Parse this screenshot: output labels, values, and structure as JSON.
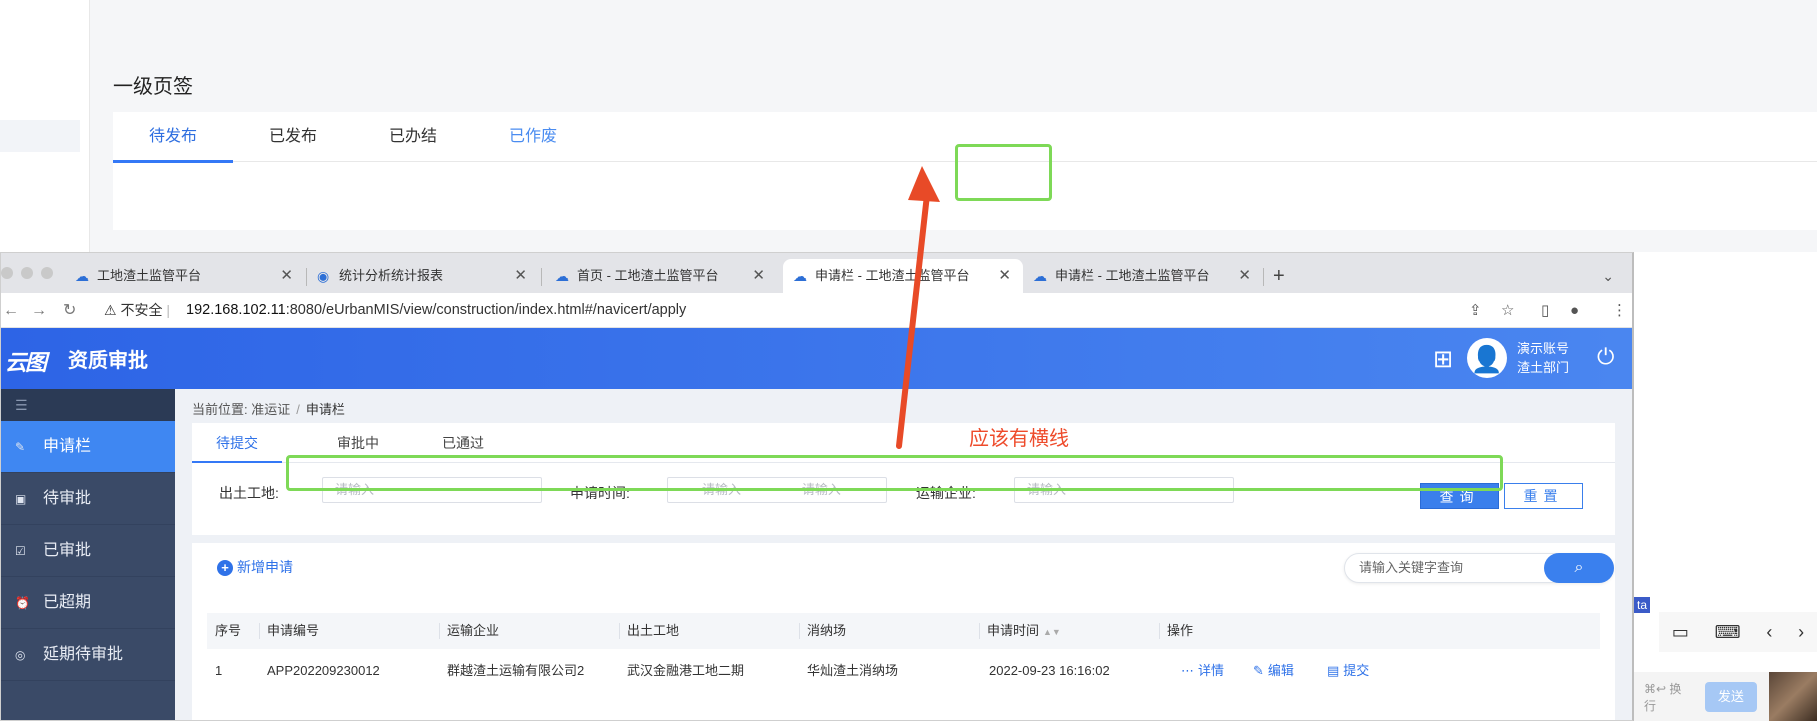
{
  "background_page": {
    "title": "一级页签",
    "tabs": [
      {
        "label": "待发布",
        "state": "active"
      },
      {
        "label": "已发布",
        "state": "normal"
      },
      {
        "label": "已办结",
        "state": "normal"
      },
      {
        "label": "已作废",
        "state": "highlight"
      }
    ],
    "side_tag": "ta",
    "chat_hint": "⌘↩ 换行",
    "chat_send": "发送"
  },
  "browser": {
    "tabs": [
      {
        "title": "工地渣土监管平台",
        "icon": "cloud-icon"
      },
      {
        "title": "统计分析统计报表",
        "icon": "globe-icon"
      },
      {
        "title": "首页 - 工地渣土监管平台",
        "icon": "cloud-icon"
      },
      {
        "title": "申请栏 - 工地渣土监管平台",
        "icon": "cloud-icon",
        "active": true
      },
      {
        "title": "申请栏 - 工地渣土监管平台",
        "icon": "cloud-icon"
      }
    ],
    "insecure_label": "不安全",
    "url_host": "192.168.102.11",
    "url_rest": ":8080/eUrbanMIS/view/construction/index.html#/navicert/apply"
  },
  "app": {
    "logo": "云图",
    "title": "资质审批",
    "user_name": "演示账号",
    "user_dept": "渣土部门",
    "sidebar": [
      {
        "label": "申请栏",
        "active": true,
        "icon": "edit-icon"
      },
      {
        "label": "待审批",
        "active": false,
        "icon": "clipboard-icon"
      },
      {
        "label": "已审批",
        "active": false,
        "icon": "check-icon"
      },
      {
        "label": "已超期",
        "active": false,
        "icon": "alarm-icon"
      },
      {
        "label": "延期待审批",
        "active": false,
        "icon": "user-icon"
      }
    ],
    "breadcrumb": {
      "prefix": "当前位置:",
      "parent": "准运证",
      "sep": "/",
      "current": "申请栏"
    },
    "filter_tabs": [
      "待提交",
      "审批中",
      "已通过"
    ],
    "filters": {
      "site_label": "出土工地:",
      "site_placeholder": "请输入",
      "time_label": "申请时间:",
      "time_start_placeholder": "请输入",
      "time_tilde": "~",
      "time_end_placeholder": "请输入",
      "company_label": "运输企业:",
      "company_placeholder": "请输入",
      "query_button": "查询",
      "reset_button": "重置"
    },
    "add_button": "新增申请",
    "keyword_placeholder": "请输入关键字查询",
    "table": {
      "headers": [
        "序号",
        "申请编号",
        "运输企业",
        "出土工地",
        "消纳场",
        "申请时间",
        "操作"
      ],
      "rows": [
        {
          "index": "1",
          "code": "APP202209230012",
          "company": "群越渣土运输有限公司2",
          "site": "武汉金融港工地二期",
          "dump": "华灿渣土消纳场",
          "time": "2022-09-23 16:16:02",
          "ops": [
            "详情",
            "编辑",
            "提交"
          ]
        }
      ]
    }
  },
  "annotation": {
    "text": "应该有横线",
    "box_color": "#7ed957",
    "arrow_color": "#e84a27"
  }
}
